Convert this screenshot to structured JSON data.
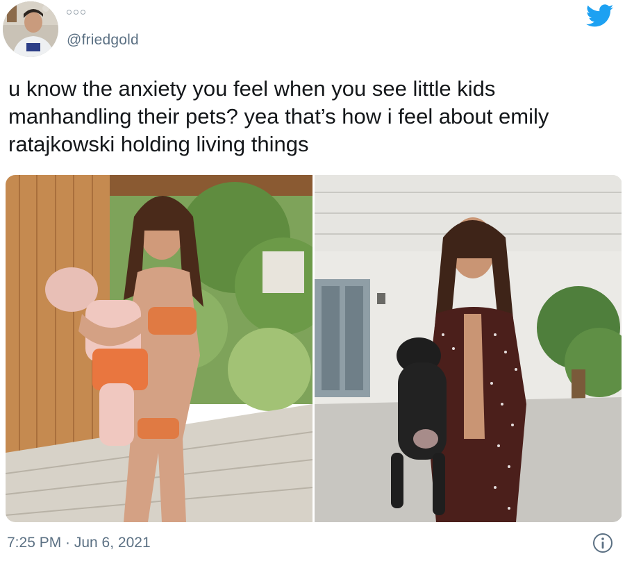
{
  "tweet": {
    "handle": "@friedgold",
    "text": "u know the anxiety you feel when you see little kids manhandling their pets? yea that’s how i feel about emily ratajkowski holding living things",
    "timestamp": "7:25 PM · Jun 6, 2021"
  },
  "icons": {
    "brand": "twitter-bird-icon",
    "info": "info-icon",
    "more": "more-dots-icon"
  },
  "colors": {
    "brand_blue": "#1da1f2",
    "secondary_text": "#5b7083",
    "primary_text": "#14171a"
  }
}
